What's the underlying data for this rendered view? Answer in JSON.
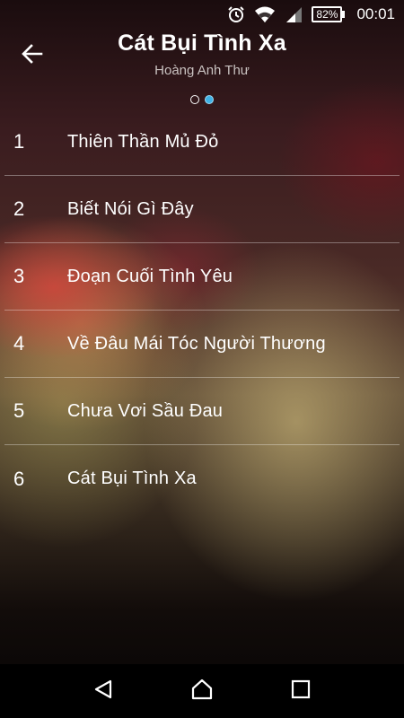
{
  "status_bar": {
    "battery": "82%",
    "time": "00:01",
    "icons": [
      "alarm-icon",
      "wifi-icon",
      "signal-icon",
      "battery-icon"
    ]
  },
  "header": {
    "title": "Cát Bụi Tình Xa",
    "subtitle": "Hoàng Anh Thư",
    "back_icon": "arrow-left-icon",
    "pages": 2,
    "active_page": 2
  },
  "tracks": [
    {
      "number": "1",
      "title": "Thiên Thần Mủ Đỏ"
    },
    {
      "number": "2",
      "title": "Biết Nói Gì Đây"
    },
    {
      "number": "3",
      "title": "Đoạn Cuối Tình Yêu"
    },
    {
      "number": "4",
      "title": "Về Đâu Mái Tóc Người Thương"
    },
    {
      "number": "5",
      "title": "Chưa Vơi Sầu Đau"
    },
    {
      "number": "6",
      "title": "Cát Bụi Tình Xa"
    }
  ],
  "nav_bar": {
    "icons": [
      "back-triangle-icon",
      "home-icon",
      "recents-square-icon"
    ]
  },
  "colors": {
    "accent": "#3fb2e6",
    "text": "#ffffff",
    "subtitle": "#c9c2c0"
  }
}
